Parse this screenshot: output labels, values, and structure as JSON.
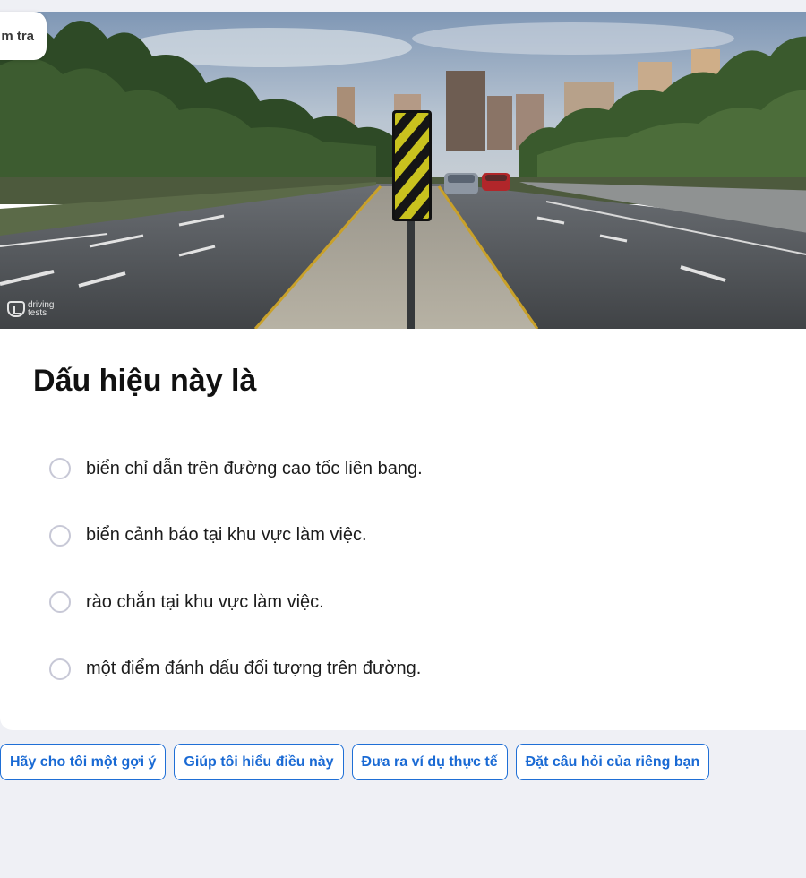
{
  "header": {
    "check_button_label": "m tra"
  },
  "image": {
    "watermark_line1": "driving",
    "watermark_line2": "tests"
  },
  "question": {
    "title": "Dấu hiệu này là",
    "options": [
      "biển chỉ dẫn trên đường cao tốc liên bang.",
      "biển cảnh báo tại khu vực làm việc.",
      "rào chắn tại khu vực làm việc.",
      "một điểm đánh dấu đối tượng trên đường."
    ]
  },
  "suggestions": [
    "Hãy cho tôi một gợi ý",
    "Giúp tôi hiểu điều này",
    "Đưa ra ví dụ thực tế",
    "Đặt câu hỏi của riêng bạn"
  ],
  "colors": {
    "page_bg": "#eff0f5",
    "accent": "#1f6fd6",
    "sign_yellow": "#c9c21e",
    "sign_black": "#151515"
  }
}
